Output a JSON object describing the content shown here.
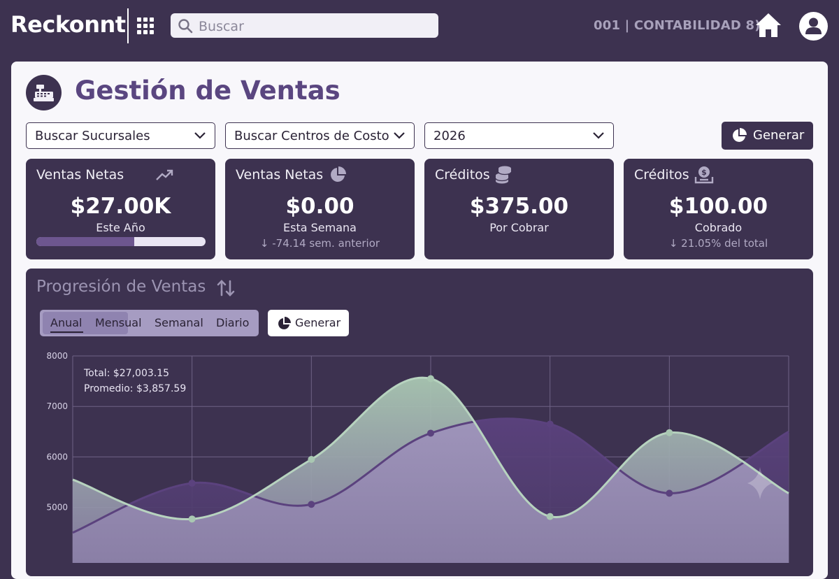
{
  "header": {
    "logo": "Reckonnt",
    "search_placeholder": "Buscar",
    "company": "001 | CONTABILIDAD 8)"
  },
  "page": {
    "title": "Gestión de Ventas"
  },
  "filters": {
    "branches": "Buscar Sucursales",
    "cost_centers": "Buscar Centros de Costo",
    "year": "2026",
    "generate": "Generar"
  },
  "kpis": [
    {
      "title": "Ventas Netas",
      "icon": "trending-up-icon",
      "value": "$27.00K",
      "sub": "Este Año",
      "progress": 0.58
    },
    {
      "title": "Ventas Netas",
      "icon": "pie-chart-icon",
      "value": "$0.00",
      "sub": "Esta Semana",
      "note": "↓ -74.14 sem. anterior"
    },
    {
      "title": "Créditos",
      "icon": "coins-icon",
      "value": "$375.00",
      "sub": "Por Cobrar"
    },
    {
      "title": "Créditos",
      "icon": "money-inbox-icon",
      "value": "$100.00",
      "sub": "Cobrado",
      "note": "↓ 21.05% del total"
    }
  ],
  "progression": {
    "title": "Progresión de Ventas",
    "tabs": [
      "Anual",
      "Mensual",
      "Semanal",
      "Diario"
    ],
    "active_tab": "Anual",
    "generate": "Generar",
    "total": "Total: $27,003.15",
    "average": "Promedio: $3,857.59"
  },
  "colors": {
    "primary": "#3d3250",
    "title": "#5a4680",
    "green_series": "#a9c7b2",
    "purple_series": "#5b427e"
  },
  "chart_data": {
    "type": "area",
    "x_index": [
      0,
      1,
      2,
      3,
      4,
      5,
      6
    ],
    "ylim": [
      4000,
      8000
    ],
    "yticks": [
      5000,
      6000,
      7000,
      8000
    ],
    "grid": true,
    "series": [
      {
        "values": [
          5550,
          4770,
          5950,
          7550,
          4820,
          6480,
          5280
        ]
      },
      {
        "values": [
          4500,
          5480,
          5060,
          6470,
          6650,
          5280,
          6500
        ]
      }
    ]
  }
}
